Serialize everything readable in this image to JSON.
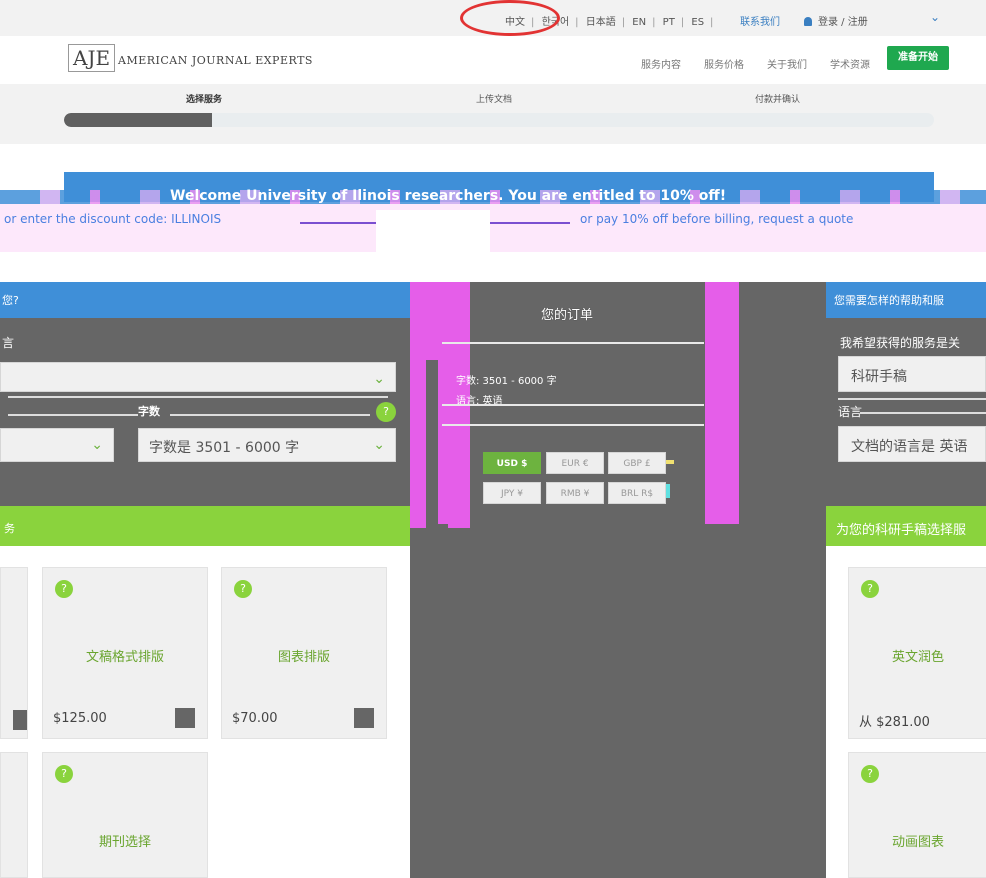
{
  "topbar": {
    "languages": [
      "中文",
      "한국어",
      "日本語",
      "EN",
      "PT",
      "ES"
    ],
    "contact": "联系我们",
    "login": "登录 / 注册"
  },
  "header": {
    "logo_mark": "AJE",
    "logo_text": "AMERICAN JOURNAL EXPERTS",
    "nav": [
      "服务内容",
      "服务价格",
      "关于我们",
      "学术资源"
    ],
    "start_button": "准备开始"
  },
  "progress": {
    "steps": [
      "选择服务",
      "上传文档",
      "付款并确认"
    ],
    "fraction": 0.17
  },
  "banner": {
    "text": "Welcome University of Ilinois researchers. You are entitled to 10% off!",
    "line1": "or enter the discount code: ILLINOIS",
    "line2": "or pay 10% off before billing, request a quote"
  },
  "left": {
    "header": "您?",
    "label": "言",
    "words_label": "字数",
    "help": "?",
    "words_value": "字数是 3501 - 6000 字",
    "section": "务",
    "cards": [
      {
        "title": "文稿格式排版",
        "price": "$125.00"
      },
      {
        "title": "图表排版",
        "price": "$70.00"
      },
      {
        "title": "期刊选择"
      }
    ]
  },
  "order": {
    "title": "您的订单",
    "line1": "字数: 3501 - 6000 字",
    "line2": "语言: 英语",
    "currencies": [
      "USD $",
      "EUR €",
      "GBP £",
      "JPY ¥",
      "RMB ¥",
      "BRL R$"
    ]
  },
  "right": {
    "header": "您需要怎样的帮助和服",
    "label": "我希望获得的服务是关",
    "service_value": "科研手稿",
    "lang_label": "语言",
    "lang_value": "文档的语言是 英语",
    "section": "为您的科研手稿选择服",
    "cards": [
      {
        "title": "英文润色",
        "price": "从 $281.00"
      },
      {
        "title": "动画图表"
      }
    ]
  },
  "colors": {
    "blue": "#3f8fd8",
    "green": "#8ad33d",
    "start_green": "#1fa84f",
    "dark_gray": "#666666",
    "magenta": "#e55ee9"
  }
}
